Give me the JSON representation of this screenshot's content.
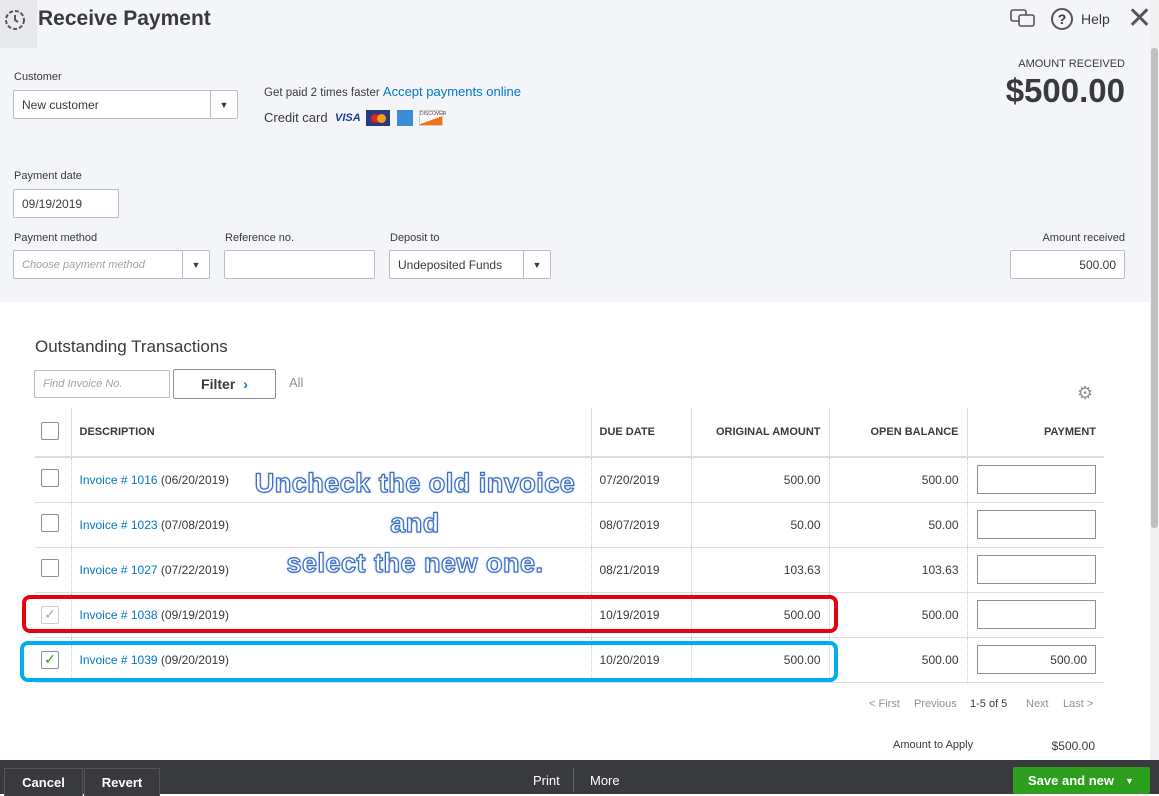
{
  "header": {
    "title": "Receive Payment",
    "help": "Help",
    "amount_received_label": "AMOUNT RECEIVED",
    "amount_received": "$500.00"
  },
  "customer": {
    "label": "Customer",
    "value": "New customer"
  },
  "promo": {
    "text": "Get paid 2 times faster",
    "link": "Accept payments online",
    "credit_card": "Credit card",
    "cards": [
      "VISA",
      "MasterCard",
      "American Express",
      "DISCOVER"
    ]
  },
  "payment_date": {
    "label": "Payment date",
    "value": "09/19/2019"
  },
  "payment_method": {
    "label": "Payment method",
    "placeholder": "Choose payment method"
  },
  "reference": {
    "label": "Reference no.",
    "value": ""
  },
  "deposit_to": {
    "label": "Deposit to",
    "value": "Undeposited Funds"
  },
  "amount_received_field": {
    "label": "Amount received",
    "value": "500.00"
  },
  "outstanding": {
    "title": "Outstanding Transactions",
    "find_placeholder": "Find Invoice No.",
    "filter": "Filter",
    "all": "All",
    "columns": [
      "DESCRIPTION",
      "DUE DATE",
      "ORIGINAL AMOUNT",
      "OPEN BALANCE",
      "PAYMENT"
    ],
    "rows": [
      {
        "link": "Invoice # 1016",
        "date": "(06/20/2019)",
        "due": "07/20/2019",
        "original": "500.00",
        "open": "500.00",
        "payment": "",
        "checked": false
      },
      {
        "link": "Invoice # 1023",
        "date": "(07/08/2019)",
        "due": "08/07/2019",
        "original": "50.00",
        "open": "50.00",
        "payment": "",
        "checked": false
      },
      {
        "link": "Invoice # 1027",
        "date": "(07/22/2019)",
        "due": "08/21/2019",
        "original": "103.63",
        "open": "103.63",
        "payment": "",
        "checked": false
      },
      {
        "link": "Invoice # 1038",
        "date": "(09/19/2019)",
        "due": "10/19/2019",
        "original": "500.00",
        "open": "500.00",
        "payment": "",
        "checked": false
      },
      {
        "link": "Invoice # 1039",
        "date": "(09/20/2019)",
        "due": "10/20/2019",
        "original": "500.00",
        "open": "500.00",
        "payment": "500.00",
        "checked": true
      }
    ],
    "pagination": {
      "first": "< First",
      "previous": "Previous",
      "range": "1-5 of 5",
      "next": "Next",
      "last": "Last >"
    },
    "amount_to_apply_label": "Amount to Apply",
    "amount_to_apply": "$500.00"
  },
  "annotation": [
    "Uncheck the old invoice",
    "and",
    "select the new one."
  ],
  "footer": {
    "cancel": "Cancel",
    "revert": "Revert",
    "print": "Print",
    "more": "More",
    "save": "Save and new"
  },
  "colors": {
    "link": "#0077c5",
    "green": "#2ca01c",
    "red_box": "#e8000b",
    "blue_box": "#00aeef"
  }
}
